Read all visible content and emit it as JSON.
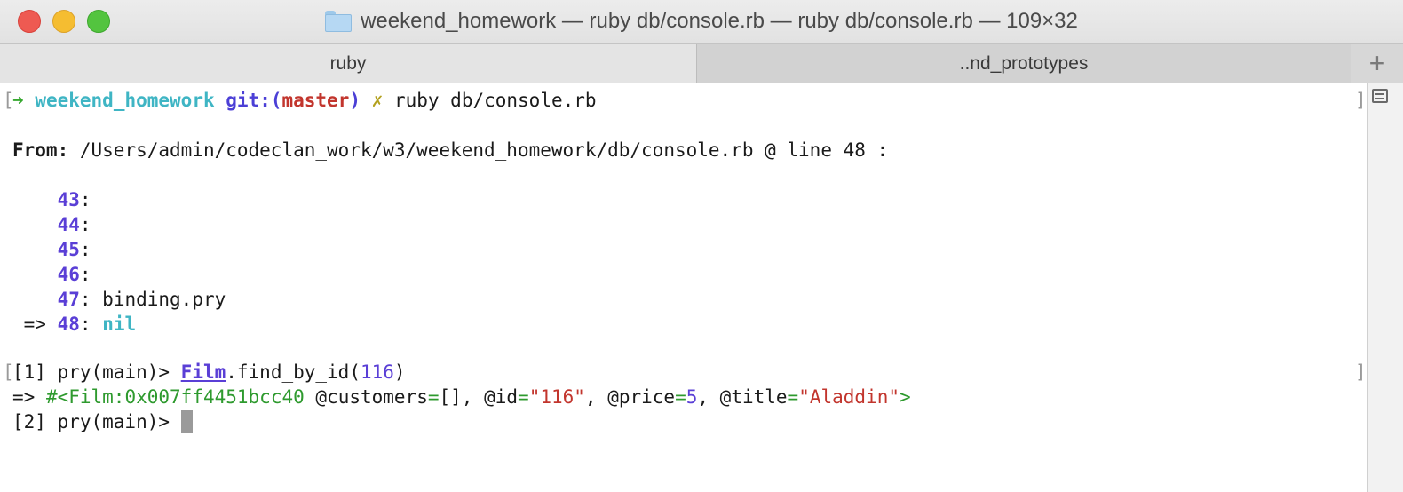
{
  "window": {
    "title": "weekend_homework — ruby db/console.rb — ruby db/console.rb — 109×32"
  },
  "tabs": [
    {
      "label": "ruby",
      "active": true
    },
    {
      "label": "..nd_prototypes",
      "active": false
    }
  ],
  "tab_add_label": "+",
  "terminal": {
    "prompt": {
      "arrow": "➜",
      "dir": "weekend_homework",
      "git_prefix": "git:(",
      "branch": "master",
      "git_suffix": ")",
      "dirty": "✗",
      "command": "ruby db/console.rb"
    },
    "from": {
      "label": "From:",
      "path": "/Users/admin/codeclan_work/w3/weekend_homework/db/console.rb @ line 48 :"
    },
    "code_lines": [
      {
        "num": "43",
        "text": ""
      },
      {
        "num": "44",
        "text": ""
      },
      {
        "num": "45",
        "text": ""
      },
      {
        "num": "46",
        "text": ""
      },
      {
        "num": "47",
        "text": "binding.pry"
      }
    ],
    "current_line": {
      "indicator": "=>",
      "num": "48",
      "text": "nil"
    },
    "pry1": {
      "prompt": "[1] pry(main)>",
      "class_name": "Film",
      "method": ".find_by_id(",
      "arg": "116",
      "close": ")"
    },
    "result": {
      "arrow": "=>",
      "object": "#<Film:0x007ff4451bcc40",
      "customers_attr": "@customers",
      "customers_value": "[]",
      "id_attr": "@id",
      "id_value": "\"116\"",
      "price_attr": "@price",
      "price_value": "5",
      "title_attr": "@title",
      "title_value": "\"Aladdin\"",
      "end": ">"
    },
    "pry2": {
      "prompt": "[2] pry(main)>"
    },
    "margin_marks": {
      "left": "[",
      "right": "]"
    }
  },
  "colors": {
    "close": "#ee5a52",
    "minimize": "#f5bd31",
    "maximize": "#53c43f"
  }
}
